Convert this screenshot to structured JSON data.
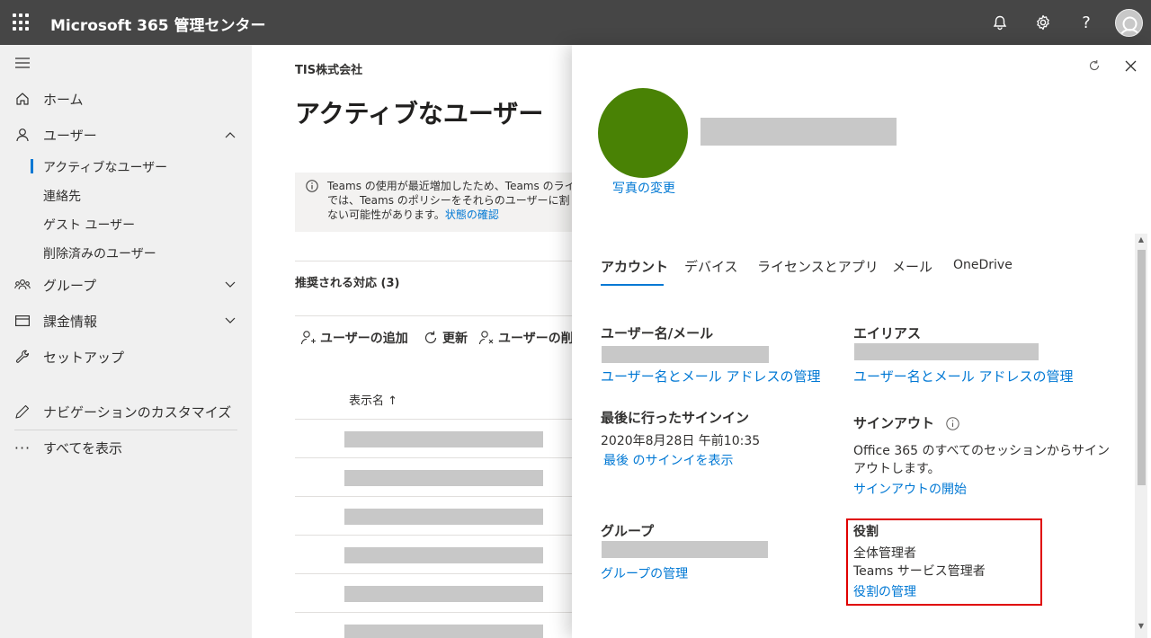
{
  "header": {
    "app_title": "Microsoft 365 管理センター",
    "icons": [
      "waffle-icon",
      "bell-icon",
      "gear-icon",
      "help-icon",
      "avatar"
    ]
  },
  "nav": {
    "home": "ホーム",
    "users": "ユーザー",
    "users_sub": [
      "アクティブなユーザー",
      "連絡先",
      "ゲスト ユーザー",
      "削除済みのユーザー"
    ],
    "groups": "グループ",
    "billing": "課金情報",
    "setup": "セットアップ",
    "customize": "ナビゲーションのカスタマイズ",
    "show_all": "すべてを表示"
  },
  "main": {
    "org_name": "TIS株式会社",
    "page_title": "アクティブなユーザー",
    "notice_line1": "Teams の使用が最近増加したため、Teams のライセ",
    "notice_line2": "では、Teams のポリシーをそれらのユーザーに割り",
    "notice_line3": "ない可能性があります。",
    "notice_link": "状態の確認",
    "recommended": "推奨される対応 (3)",
    "add_user": "ユーザーの追加",
    "refresh": "更新",
    "delete_user": "ユーザーの削",
    "col_display_name": "表示名 ↑"
  },
  "panel": {
    "change_photo": "写真の変更",
    "tabs": [
      "アカウント",
      "デバイス",
      "ライセンスとアプリ",
      "メール",
      "OneDrive"
    ],
    "active_tab": "アカウント",
    "username_title": "ユーザー名/メール",
    "username_link": "ユーザー名とメール アドレスの管理",
    "alias_title": "エイリアス",
    "alias_link": "ユーザー名とメール アドレスの管理",
    "last_signin_title": "最後に行ったサインイン",
    "last_signin_value": "2020年8月28日 午前10:35",
    "last_signin_link": "最後 のサインイを表示",
    "signout_title": "サインアウト",
    "signout_text1": "Office 365 のすべてのセッションからサイン",
    "signout_text2": "アウトします。",
    "signout_link": "サインアウトの開始",
    "groups_title": "グループ",
    "groups_link": "グループの管理",
    "roles_title": "役割",
    "roles": [
      "全体管理者",
      "Teams サービス管理者"
    ],
    "roles_link": "役割の管理"
  },
  "colors": {
    "topbar": "#464646",
    "accent": "#0078d4",
    "avatar": "#498205",
    "highlight": "#e00000"
  }
}
